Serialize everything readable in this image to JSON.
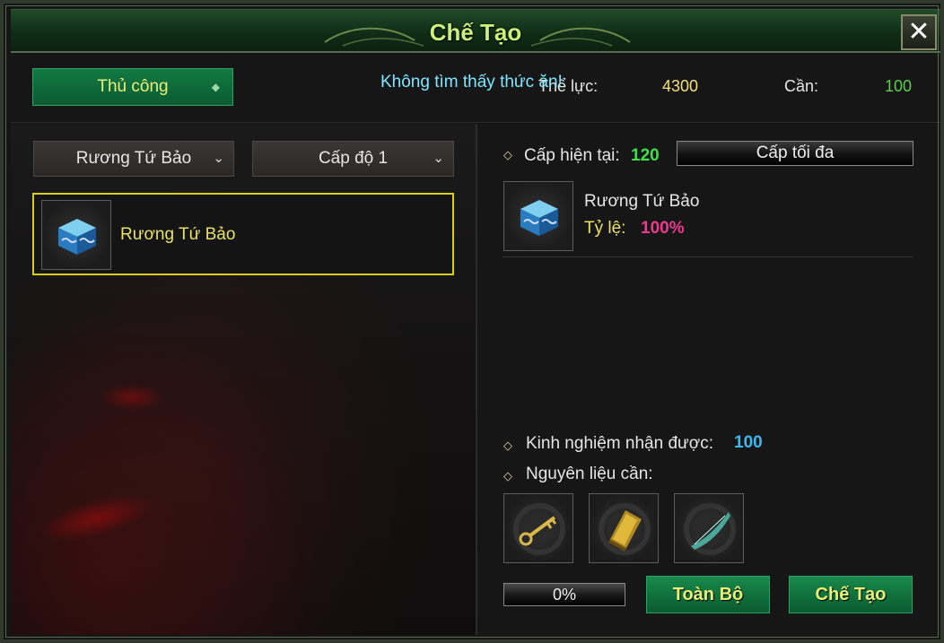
{
  "window": {
    "title": "Chế Tạo",
    "close_label": "✕"
  },
  "header": {
    "mode_label": "Thủ công",
    "overlay_message": "Không tìm thấy thức ăn!",
    "stat_label": "Thể lực:",
    "stat_value": "4300",
    "need_label": "Cần:",
    "need_value": "100"
  },
  "filters": {
    "category": "Rương Tứ Bảo",
    "level": "Cấp độ 1"
  },
  "recipes": [
    {
      "name": "Rương Tứ Bảo",
      "icon": "blue-chest-icon"
    }
  ],
  "detail": {
    "current_level_label": "Cấp hiện tại:",
    "current_level_value": "120",
    "max_button": "Cấp tối đa",
    "result_name": "Rương Tứ Bảo",
    "rate_label": "Tỷ lệ:",
    "rate_value": "100%",
    "exp_label": "Kinh nghiệm nhận được:",
    "exp_value": "100",
    "materials_label": "Nguyên liệu cần:",
    "materials": [
      {
        "icon": "gold-key-icon"
      },
      {
        "icon": "scroll-icon"
      },
      {
        "icon": "jade-blade-icon"
      }
    ],
    "progress": "0%",
    "progress_fraction": 0,
    "all_button": "Toàn Bộ",
    "craft_button": "Chế Tạo"
  },
  "colors": {
    "title": "#c8f07a",
    "accent_green": "#0a5a30",
    "selected_border": "#d8cc1c",
    "rate": "#ec3a8c",
    "exp": "#3fb8f0",
    "level": "#3fe04a"
  }
}
